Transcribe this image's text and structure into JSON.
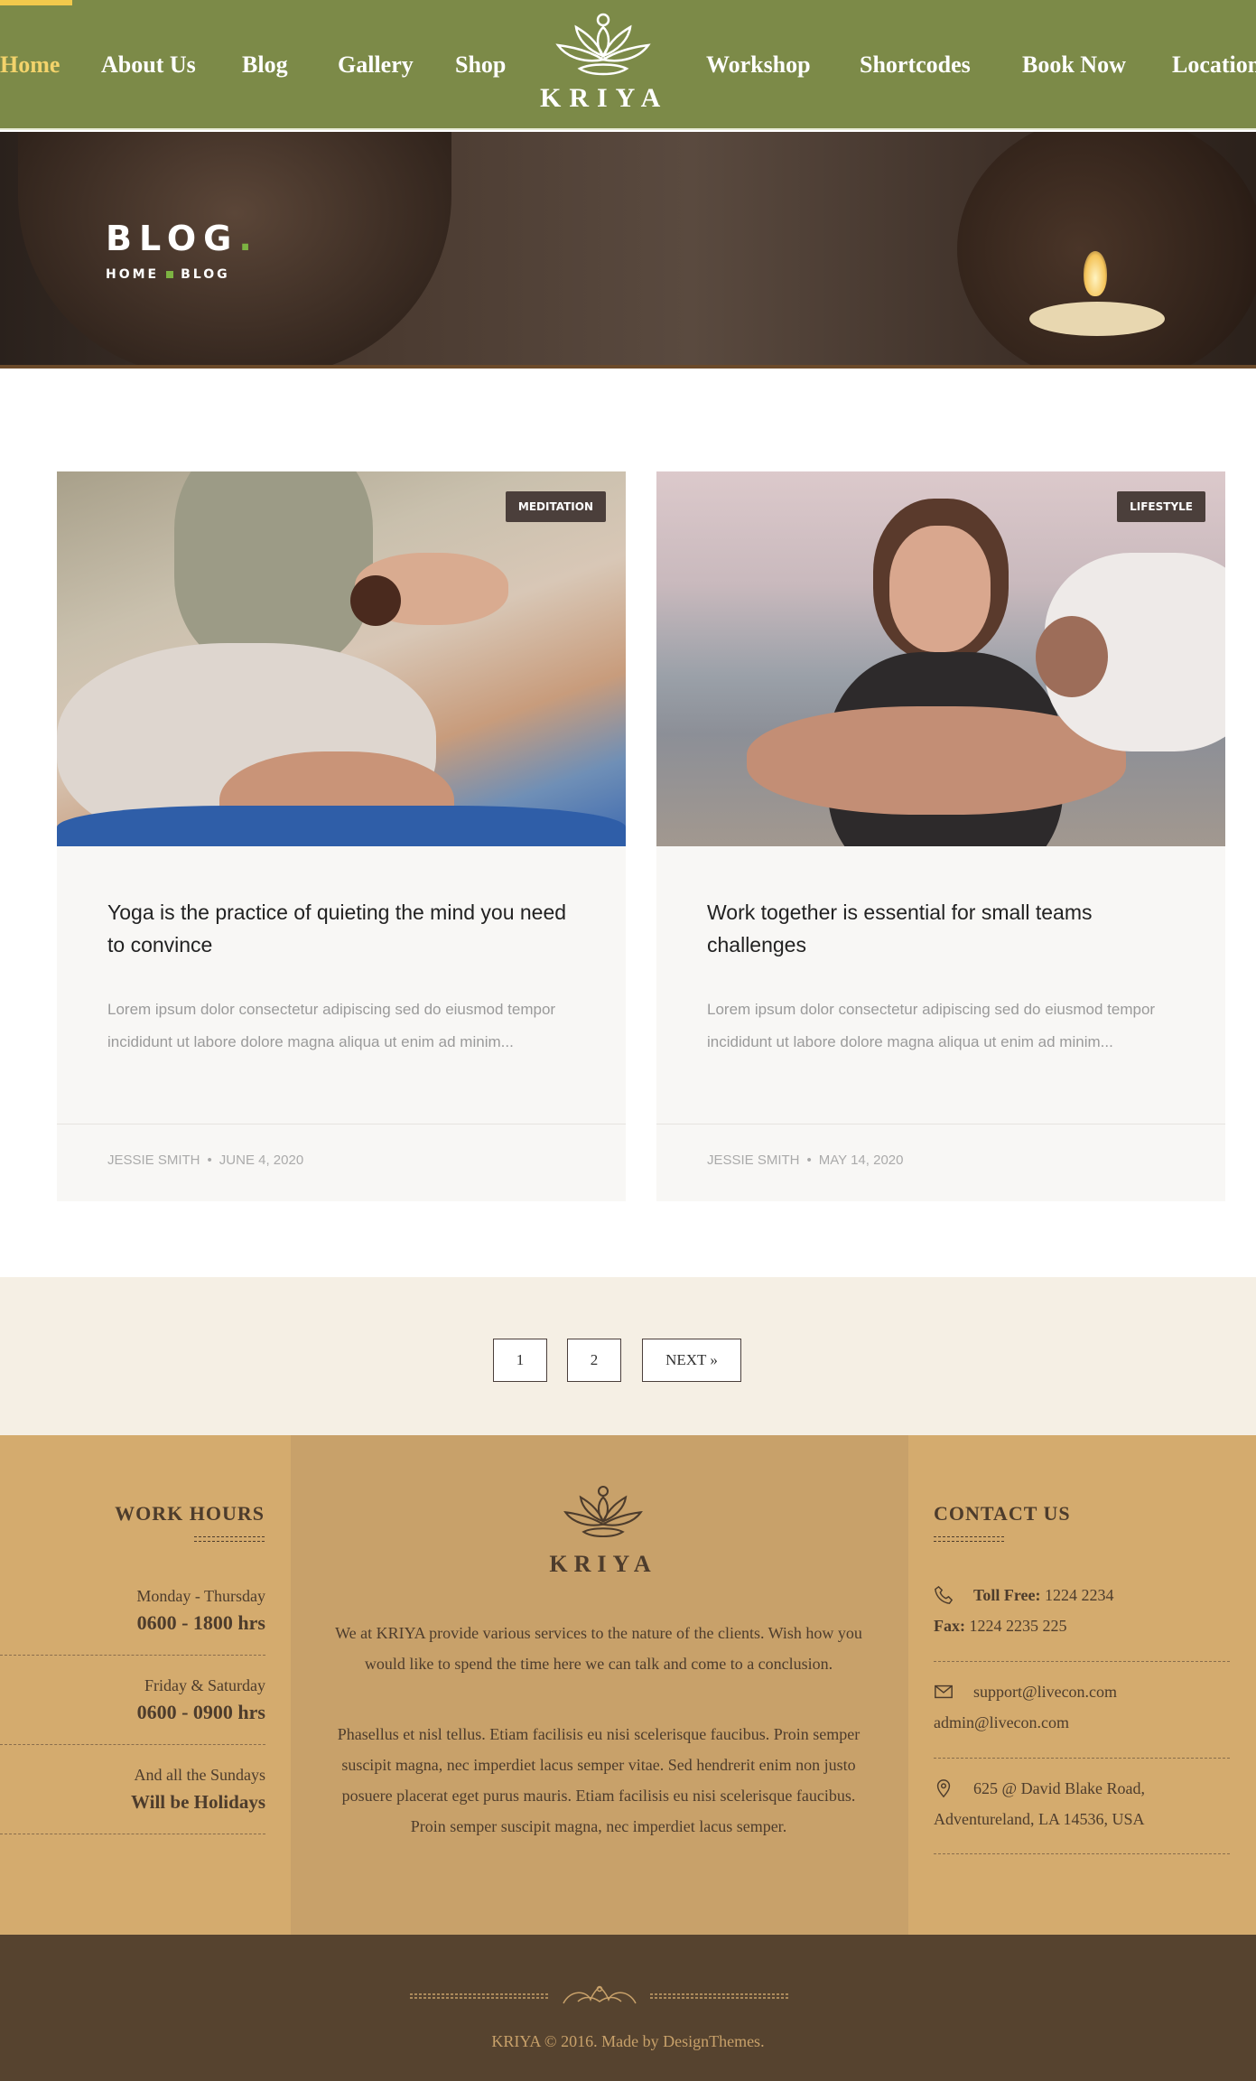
{
  "nav": {
    "items_left": [
      "Home",
      "About Us",
      "Blog",
      "Gallery",
      "Shop"
    ],
    "items_right": [
      "Workshop",
      "Shortcodes",
      "Book Now",
      "Location"
    ],
    "logo_text": "KRIYA",
    "active": "Home"
  },
  "hero": {
    "title": "BLOG",
    "title_dot": ".",
    "breadcrumb": [
      "HOME",
      "BLOG"
    ]
  },
  "posts": [
    {
      "category": "MEDITATION",
      "title": "Yoga is the practice of quieting the mind you need to convince",
      "excerpt": "Lorem ipsum dolor consectetur adipiscing sed do eiusmod tempor incididunt ut labore dolore magna aliqua ut enim ad minim...",
      "author": "JESSIE SMITH",
      "date": "JUNE 4, 2020"
    },
    {
      "category": "LIFESTYLE",
      "title": "Work together is essential for small teams challenges",
      "excerpt": "Lorem ipsum dolor consectetur adipiscing sed do eiusmod tempor incididunt ut labore dolore magna aliqua ut enim ad minim...",
      "author": "JESSIE SMITH",
      "date": "MAY 14, 2020"
    }
  ],
  "meta_separator": "•",
  "pagination": {
    "pages": [
      "1",
      "2"
    ],
    "next_label": "NEXT »"
  },
  "footer": {
    "work_hours": {
      "heading": "WORK HOURS",
      "rows": [
        {
          "day": "Monday - Thursday",
          "hours": "0600 - 1800 hrs"
        },
        {
          "day": "Friday & Saturday",
          "hours": "0600 - 0900 hrs"
        },
        {
          "day": "And all the Sundays",
          "hours": "Will be Holidays"
        }
      ]
    },
    "about": {
      "logo_text": "KRIYA",
      "para1": "We at KRIYA provide various services to the nature of the clients. Wish how you would like to spend the time here we can talk and come to a conclusion.",
      "para2": "Phasellus et nisl tellus. Etiam facilisis eu nisi scelerisque faucibus. Proin semper suscipit magna, nec imperdiet lacus semper vitae. Sed hendrerit enim non justo posuere placerat eget purus mauris. Etiam facilisis eu nisi scelerisque faucibus. Proin semper suscipit magna, nec imperdiet lacus semper."
    },
    "contact": {
      "heading": "CONTACT US",
      "toll_free_label": "Toll Free:",
      "toll_free": "1224 2234",
      "fax_label": "Fax:",
      "fax": "1224 2235 225",
      "email1": "support@livecon.com",
      "email2": "admin@livecon.com",
      "address1": "625 @ David Blake Road,",
      "address2": "Adventureland, LA 14536, USA"
    },
    "copyright": "KRIYA © 2016. Made by DesignThemes."
  },
  "colors": {
    "nav_bg": "#7c8a48",
    "nav_active": "#f3d36b",
    "accent_green": "#7cb342",
    "footer_bg": "#d4ab6e",
    "footer_mid": "#c8a16a",
    "bottom_bar": "#56432f"
  },
  "icons": [
    "lotus-logo-icon",
    "phone-icon",
    "envelope-icon",
    "map-pin-icon",
    "ornament-icon"
  ]
}
